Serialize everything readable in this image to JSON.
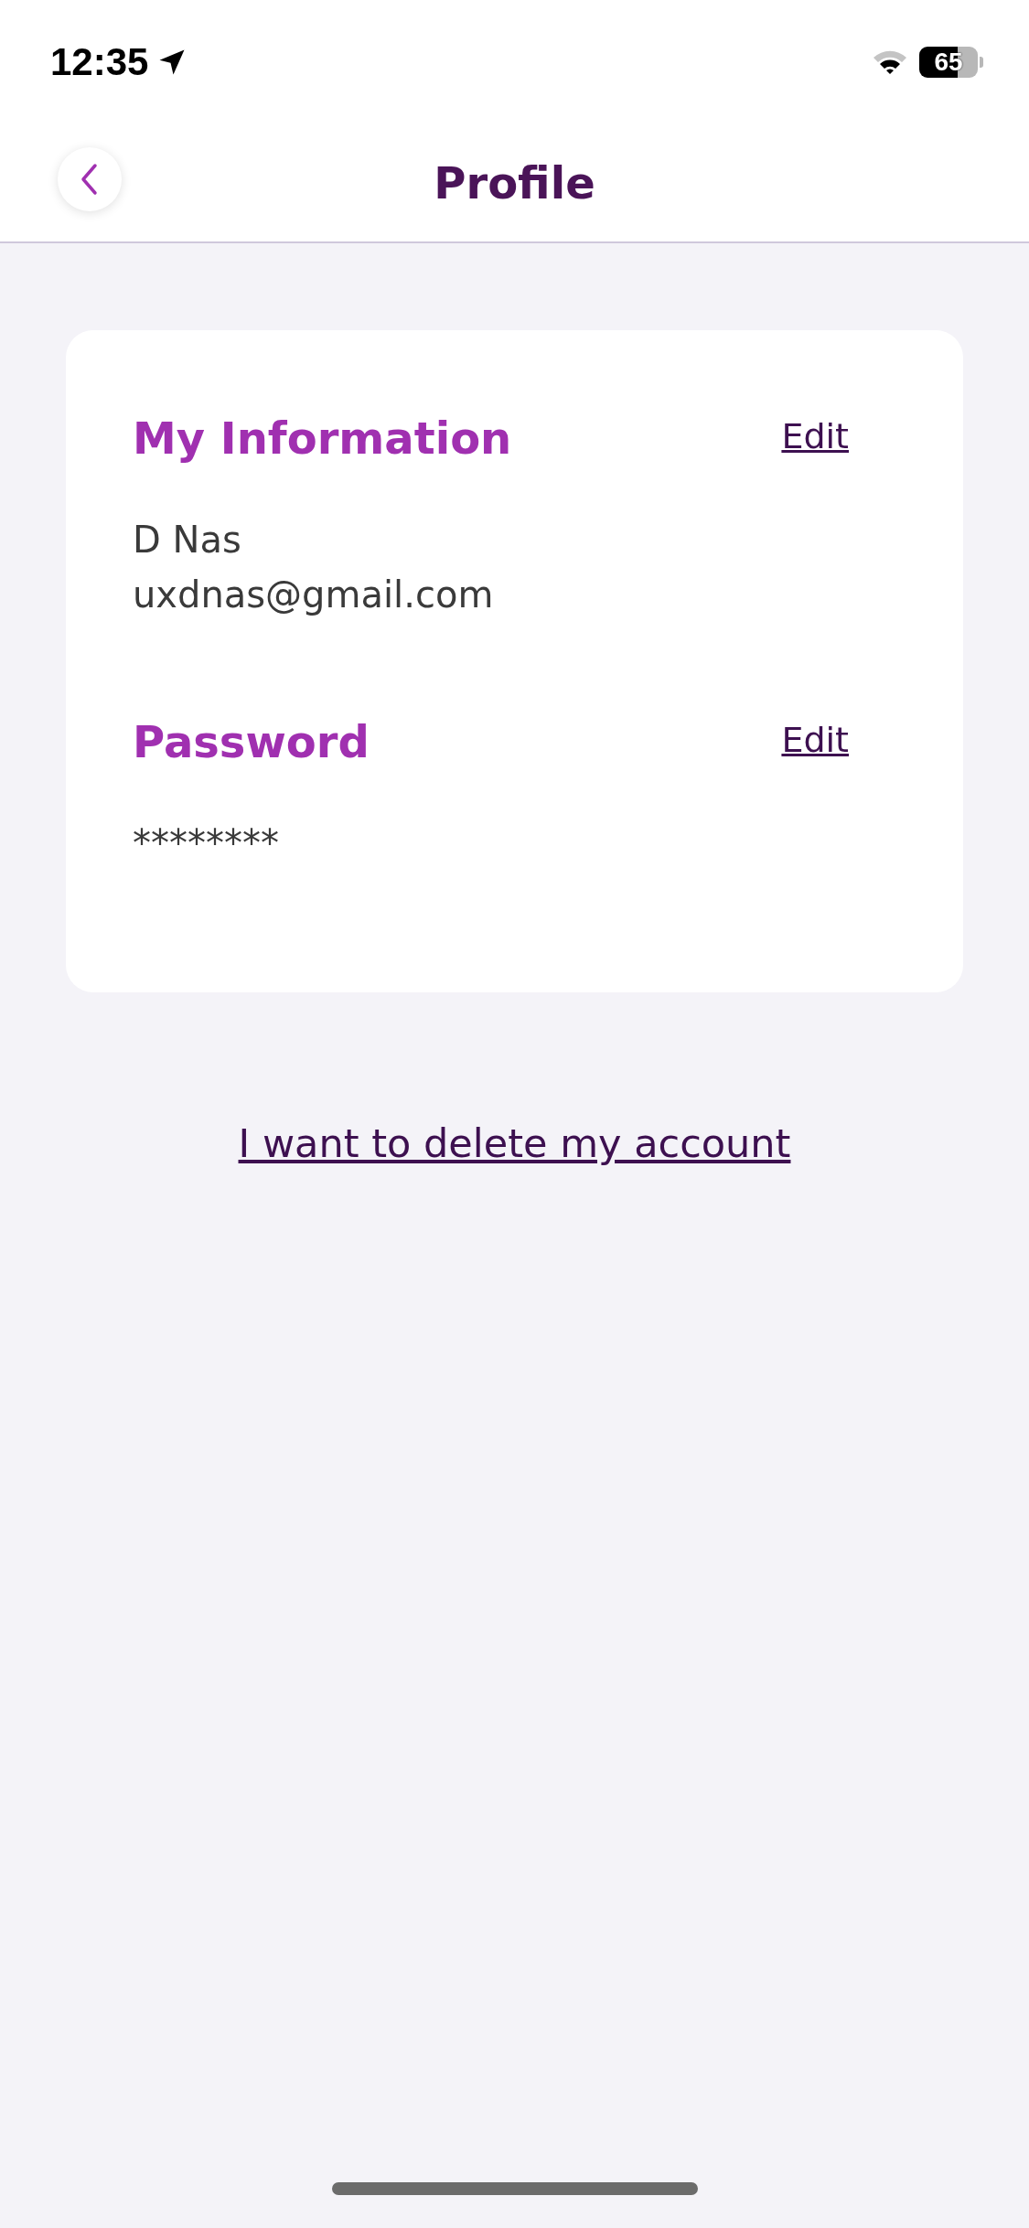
{
  "status_bar": {
    "time": "12:35",
    "battery": "65"
  },
  "header": {
    "title": "Profile"
  },
  "sections": [
    {
      "title": "My Information",
      "action": "Edit",
      "lines": [
        "D Nas",
        "uxdnas@gmail.com"
      ]
    },
    {
      "title": "Password",
      "action": "Edit",
      "lines": [
        "********"
      ]
    }
  ],
  "delete_link": "I want to delete my account"
}
